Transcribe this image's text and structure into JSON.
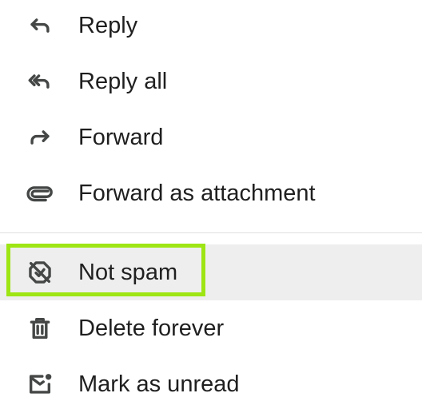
{
  "menu": {
    "items": [
      {
        "label": "Reply",
        "icon": "reply-icon"
      },
      {
        "label": "Reply all",
        "icon": "reply-all-icon"
      },
      {
        "label": "Forward",
        "icon": "forward-icon"
      },
      {
        "label": "Forward as attachment",
        "icon": "attachment-icon"
      },
      {
        "label": "Not spam",
        "icon": "not-spam-icon"
      },
      {
        "label": "Delete forever",
        "icon": "trash-icon"
      },
      {
        "label": "Mark as unread",
        "icon": "mark-unread-icon"
      }
    ]
  },
  "colors": {
    "highlight": "#9ee514",
    "hover_background": "#eeeeee",
    "icon": "#444746",
    "text": "#1f1f1f"
  }
}
